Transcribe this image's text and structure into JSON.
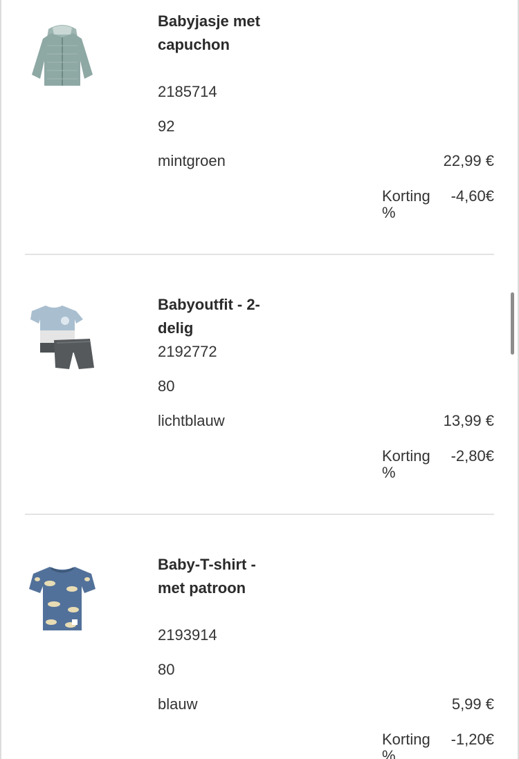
{
  "items": [
    {
      "image": "rain-jacket-hood-image",
      "name": "Babyjasje met capuchon",
      "sku": "2185714",
      "size": "92",
      "color": "mintgroen",
      "price": "22,99 €",
      "discount_label": "Korting %",
      "discount_value": "-4,60€"
    },
    {
      "image": "tshirt-shorts-outfit-image",
      "name": "Babyoutfit - 2-delig",
      "sku": "2192772",
      "size": "80",
      "color": "lichtblauw",
      "price": "13,99 €",
      "discount_label": "Korting %",
      "discount_value": "-2,80€"
    },
    {
      "image": "patterned-tshirt-image",
      "name": "Baby-T-shirt - met patroon",
      "sku": "2193914",
      "size": "80",
      "color": "blauw",
      "price": "5,99 €",
      "discount_label": "Korting %",
      "discount_value": "-1,20€"
    }
  ],
  "colors": {
    "jacket": "#8ea8a4",
    "outfit_top": "#a9bfd0",
    "outfit_shorts": "#55595c",
    "tshirt": "#52719a",
    "divider": "#e3e3e3"
  }
}
